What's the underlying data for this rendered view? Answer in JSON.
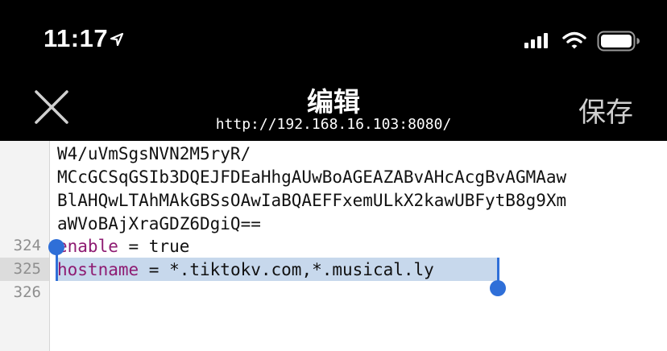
{
  "status_bar": {
    "time": "11:17",
    "icons": [
      "location-arrow-icon",
      "cellular-signal-icon",
      "wifi-icon",
      "battery-icon"
    ]
  },
  "nav": {
    "close_icon": "close-icon",
    "title": "编辑",
    "subtitle": "http://192.168.16.103:8080/",
    "save_label": "保存"
  },
  "editor": {
    "wrapped_lines": [
      "W4/uVmSgsNVN2M5ryR/",
      "MCcGCSqGSIb3DQEJFDEaHhgAUwBoAGEAZABvAHcAcgBvAGMAaw",
      "BlAHQwLTAhMAkGBSsOAwIaBQAEFFxemULkX2kawUBFytB8g9Xm",
      "aWVoBAjXraGDZ6DgiQ=="
    ],
    "lines": [
      {
        "number": "324",
        "key": "enable",
        "op": " = ",
        "value": "true"
      },
      {
        "number": "325",
        "key": "hostname",
        "op": " = ",
        "value": "*.tiktokv.com,*.musical.ly"
      },
      {
        "number": "326",
        "key": "",
        "op": "",
        "value": ""
      }
    ]
  },
  "colors": {
    "background_top": "#000000",
    "keyword": "#8e1b72",
    "selection": "#c7d8ec",
    "selection_handle": "#2f6fd8",
    "gutter": "#f3f3f3"
  }
}
